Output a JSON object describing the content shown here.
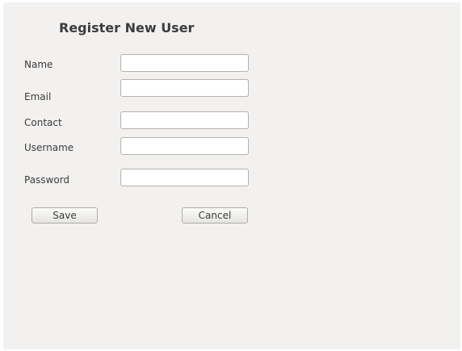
{
  "form": {
    "title": "Register New User",
    "fields": [
      {
        "label": "Name",
        "value": "",
        "placeholder": ""
      },
      {
        "label": "Email",
        "value": "",
        "placeholder": ""
      },
      {
        "label": "Contact",
        "value": "",
        "placeholder": ""
      },
      {
        "label": "Username",
        "value": "",
        "placeholder": ""
      },
      {
        "label": "Password",
        "value": "",
        "placeholder": ""
      }
    ],
    "save_label": "Save",
    "cancel_label": "Cancel"
  }
}
